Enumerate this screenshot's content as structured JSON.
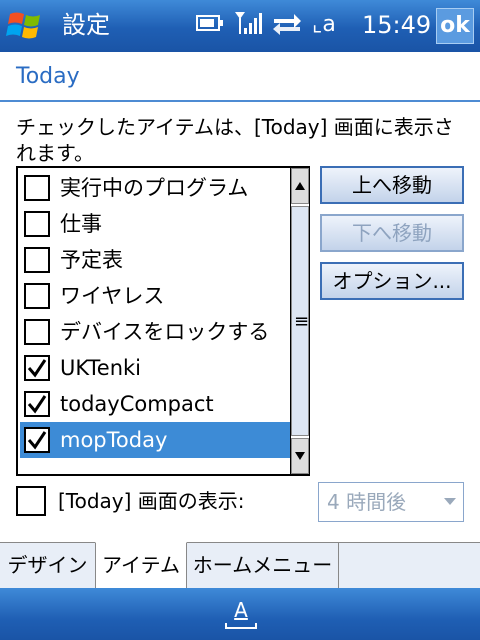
{
  "titlebar": {
    "app_title": "設定",
    "clock": "15:49",
    "ok_label": "ok",
    "signal_text": "⌞a",
    "icons": [
      "windows-logo-icon",
      "battery-icon",
      "signal-icon",
      "sync-arrows-icon",
      "input-a-icon"
    ]
  },
  "page": {
    "title": "Today",
    "instruction": "チェックしたアイテムは、[Today] 画面に表示されます。"
  },
  "list": {
    "items": [
      {
        "label": "実行中のプログラム",
        "checked": false
      },
      {
        "label": "仕事",
        "checked": false
      },
      {
        "label": "予定表",
        "checked": false
      },
      {
        "label": "ワイヤレス",
        "checked": false
      },
      {
        "label": "デバイスをロックする",
        "checked": false
      },
      {
        "label": "UKTenki",
        "checked": true
      },
      {
        "label": "todayCompact",
        "checked": true
      },
      {
        "label": "mopToday",
        "checked": true,
        "selected": true
      }
    ]
  },
  "buttons": {
    "move_up": "上へ移動",
    "move_down": "下へ移動",
    "options": "オプション..."
  },
  "today_display": {
    "label": "[Today] 画面の表示:",
    "timeout_value": "4 時間後"
  },
  "tabs": [
    {
      "label": "デザイン"
    },
    {
      "label": "アイテム",
      "active": true
    },
    {
      "label": "ホームメニュー"
    }
  ],
  "softbar": {
    "sip_label": "A"
  },
  "colors": {
    "title_bar": "#1f5fb4",
    "accent": "#2a6cc3",
    "selection": "#3d8bd6"
  }
}
